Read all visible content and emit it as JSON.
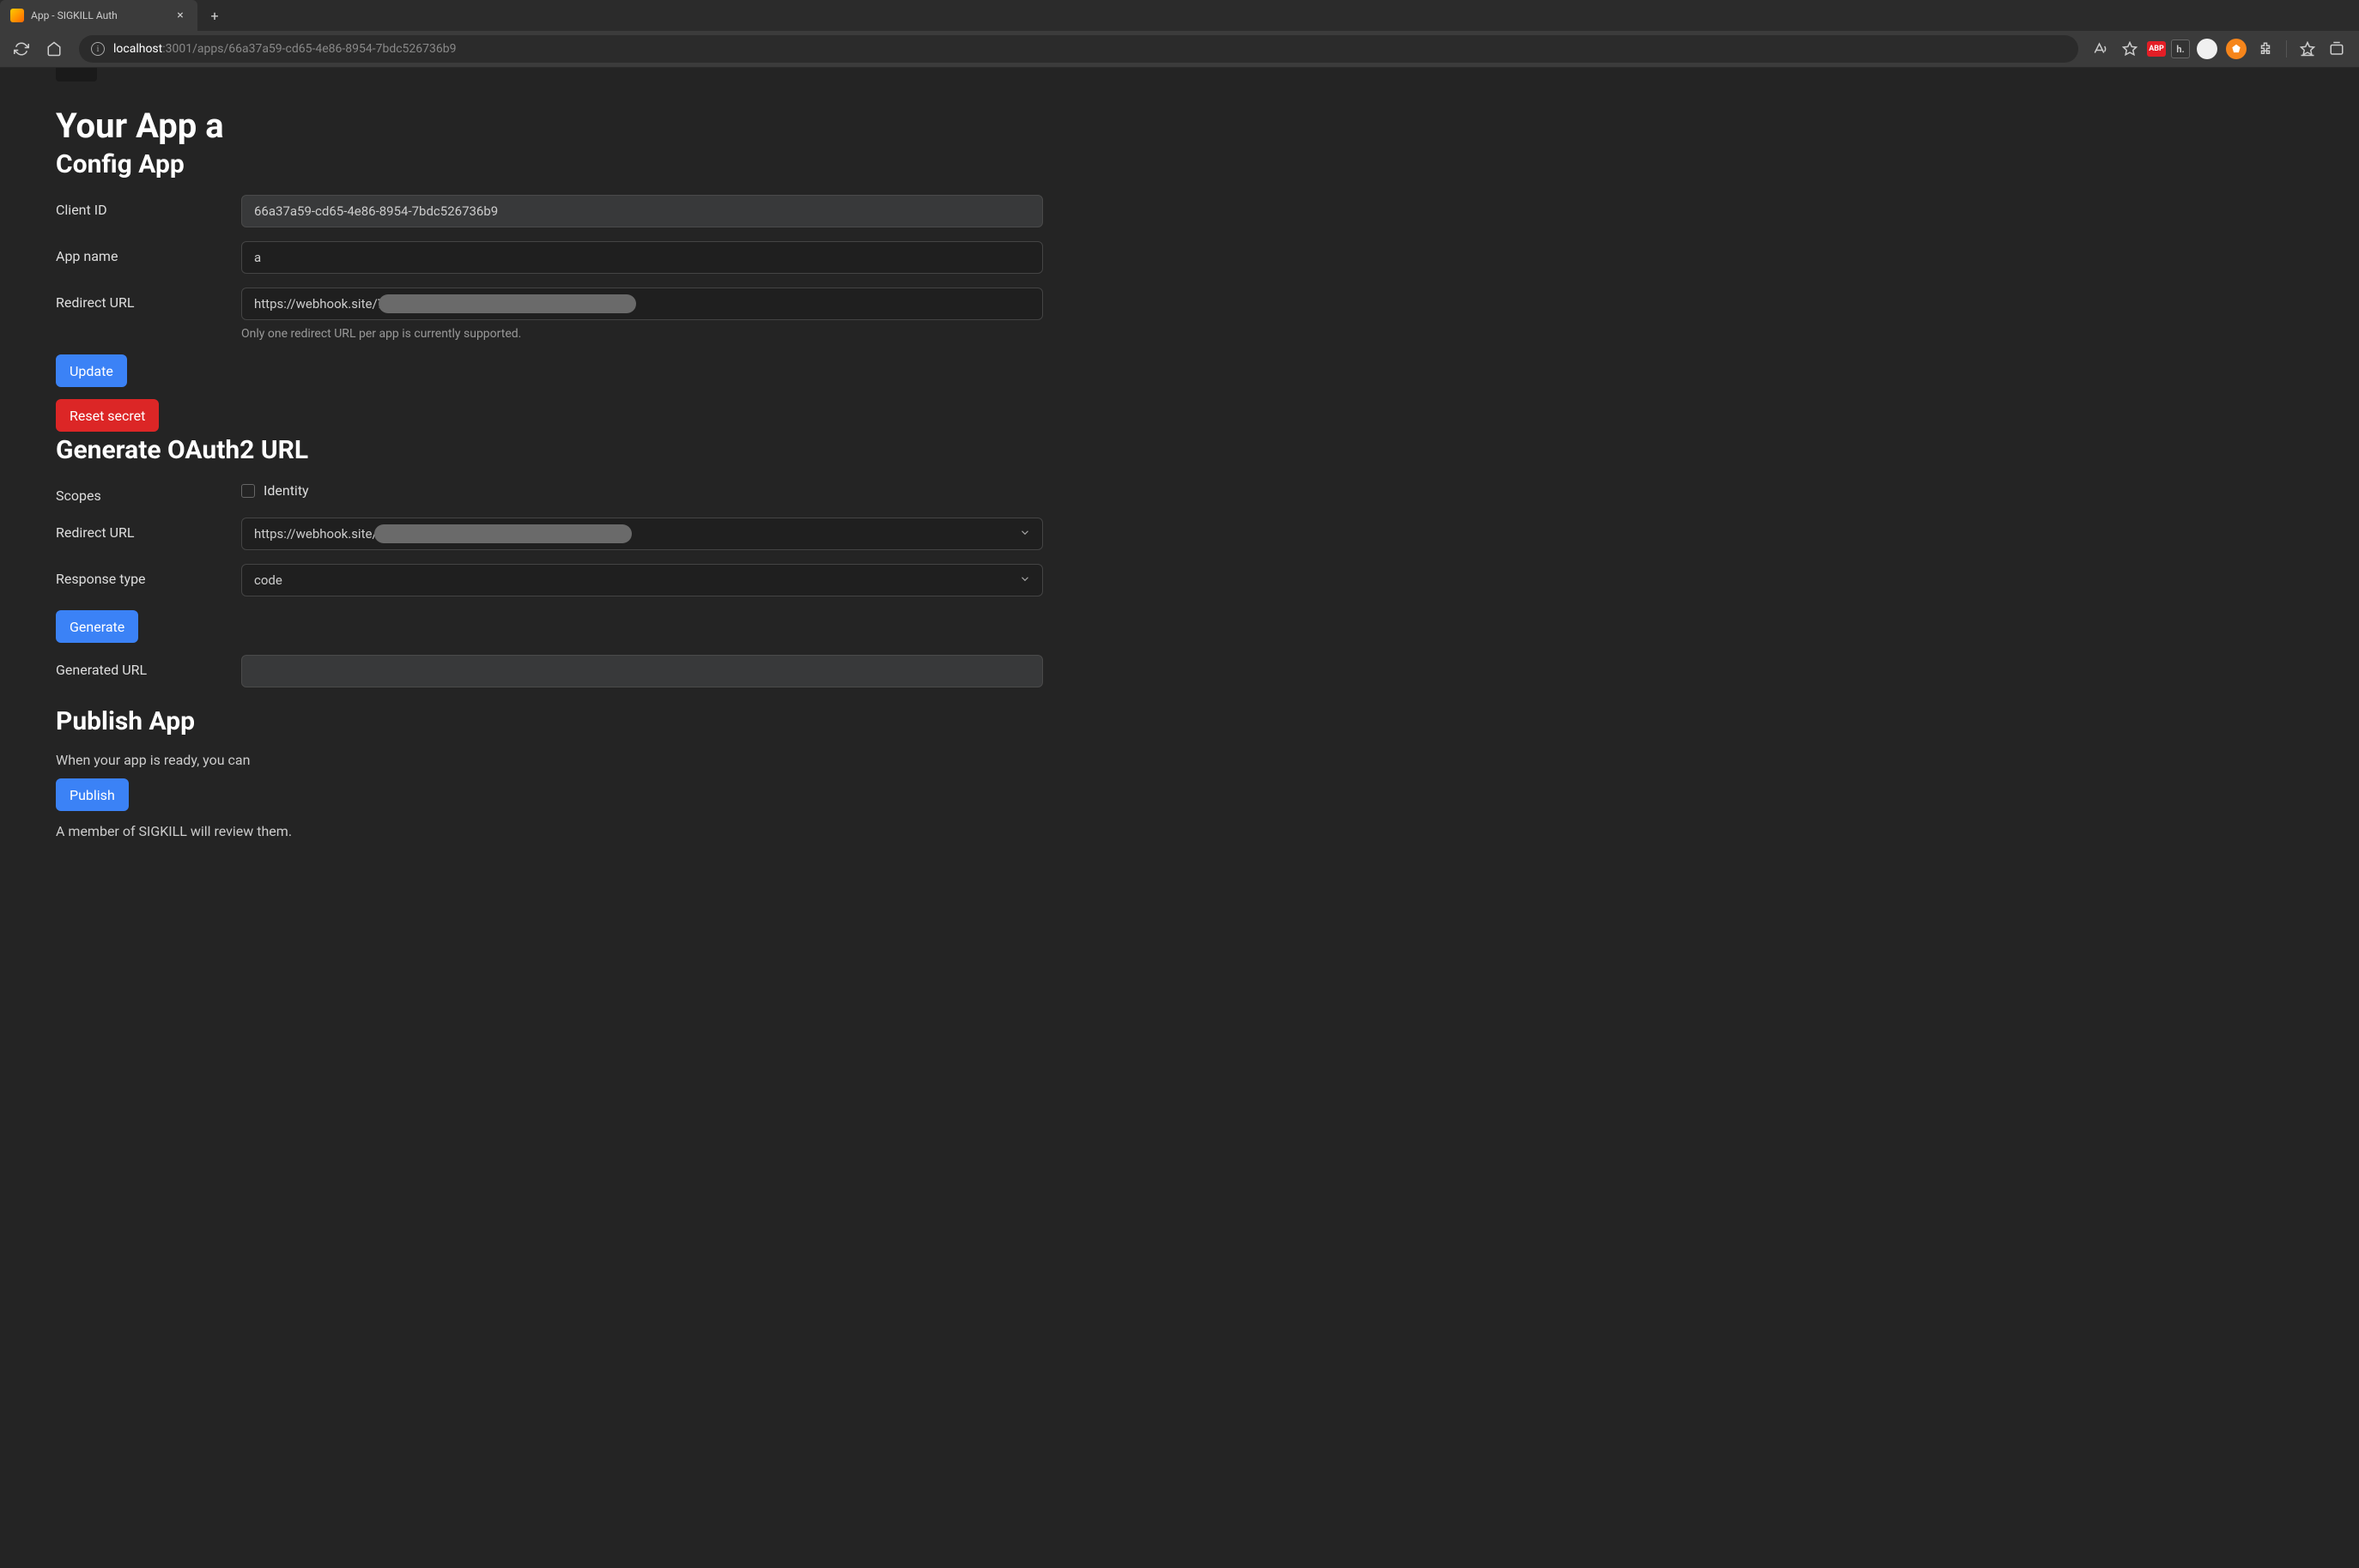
{
  "browser": {
    "tab_title": "App - SIGKILL Auth",
    "url_host": "localhost",
    "url_path": ":3001/apps/66a37a59-cd65-4e86-8954-7bdc526736b9"
  },
  "page": {
    "title": "Your App a",
    "sections": {
      "config": {
        "heading": "Config App",
        "fields": {
          "client_id": {
            "label": "Client ID",
            "value": "66a37a59-cd65-4e86-8954-7bdc526736b9"
          },
          "app_name": {
            "label": "App name",
            "value": "a"
          },
          "redirect_url": {
            "label": "Redirect URL",
            "value": "https://webhook.site/7",
            "hint": "Only one redirect URL per app is currently supported."
          }
        },
        "buttons": {
          "update": "Update",
          "reset_secret": "Reset secret"
        }
      },
      "oauth": {
        "heading": "Generate OAuth2 URL",
        "fields": {
          "scopes": {
            "label": "Scopes",
            "options": {
              "identity": "Identity"
            }
          },
          "redirect_url": {
            "label": "Redirect URL",
            "value": "https://webhook.site/"
          },
          "response_type": {
            "label": "Response type",
            "value": "code"
          },
          "generated_url": {
            "label": "Generated URL",
            "value": ""
          }
        },
        "buttons": {
          "generate": "Generate"
        }
      },
      "publish": {
        "heading": "Publish App",
        "intro": "When your app is ready, you can",
        "button": "Publish",
        "footer": "A member of SIGKILL will review them."
      }
    }
  }
}
